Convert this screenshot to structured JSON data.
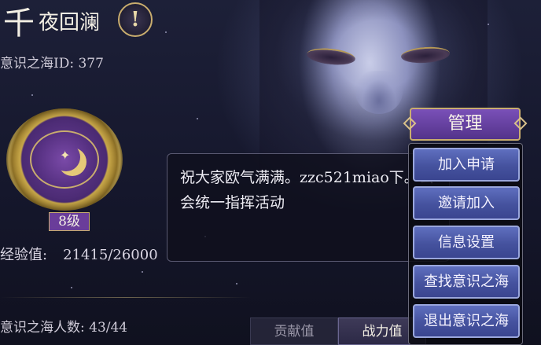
{
  "header": {
    "title_big": "千",
    "title_small": "夜回澜",
    "alert_symbol": "!",
    "id_line": "意识之海ID: 377"
  },
  "profile": {
    "level_label": "8级",
    "exp_label": "经验值:",
    "exp_value": "21415/26000",
    "members_label": "意识之海人数: 43/44"
  },
  "notice": {
    "text": "祝大家欧气满满。zzc521miao下。公会统一指挥活动"
  },
  "tabs": [
    {
      "label": "贡献值",
      "active": false
    },
    {
      "label": "战力值",
      "active": true
    }
  ],
  "manage_menu": {
    "title": "管理",
    "items": [
      {
        "label": "加入申请"
      },
      {
        "label": "邀请加入"
      },
      {
        "label": "信息设置"
      },
      {
        "label": "查找意识之海"
      },
      {
        "label": "退出意识之海"
      }
    ]
  },
  "colors": {
    "accent_purple": "#6a3d9a",
    "gold_border": "#c9ad6e",
    "button_blue": "#45529e"
  }
}
